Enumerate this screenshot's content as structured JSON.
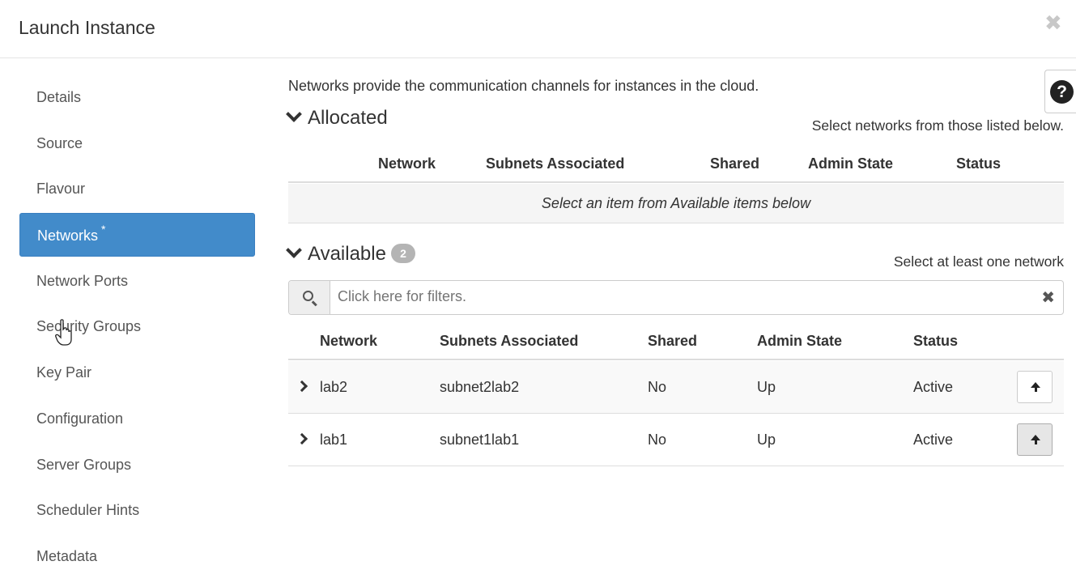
{
  "modal": {
    "title": "Launch Instance",
    "close_glyph": "✖"
  },
  "nav": {
    "items": [
      {
        "label": "Details"
      },
      {
        "label": "Source"
      },
      {
        "label": "Flavour"
      },
      {
        "label": "Networks",
        "required_mark": "*",
        "active": true
      },
      {
        "label": "Network Ports"
      },
      {
        "label": "Security Groups"
      },
      {
        "label": "Key Pair"
      },
      {
        "label": "Configuration"
      },
      {
        "label": "Server Groups"
      },
      {
        "label": "Scheduler Hints"
      },
      {
        "label": "Metadata"
      }
    ],
    "active_color": "#428bca"
  },
  "main": {
    "intro": "Networks provide the communication channels for instances in the cloud.",
    "help_glyph": "?",
    "allocated": {
      "title": "Allocated",
      "hint": "Select networks from those listed below.",
      "columns": [
        "Network",
        "Subnets Associated",
        "Shared",
        "Admin State",
        "Status"
      ],
      "empty_text": "Select an item from Available items below"
    },
    "available": {
      "title": "Available",
      "count": "2",
      "hint": "Select at least one network",
      "filter_placeholder": "Click here for filters.",
      "columns": [
        "Network",
        "Subnets Associated",
        "Shared",
        "Admin State",
        "Status"
      ],
      "rows": [
        {
          "network": "lab2",
          "subnets": "subnet2lab2",
          "shared": "No",
          "admin_state": "Up",
          "status": "Active"
        },
        {
          "network": "lab1",
          "subnets": "subnet1lab1",
          "shared": "No",
          "admin_state": "Up",
          "status": "Active"
        }
      ]
    }
  }
}
